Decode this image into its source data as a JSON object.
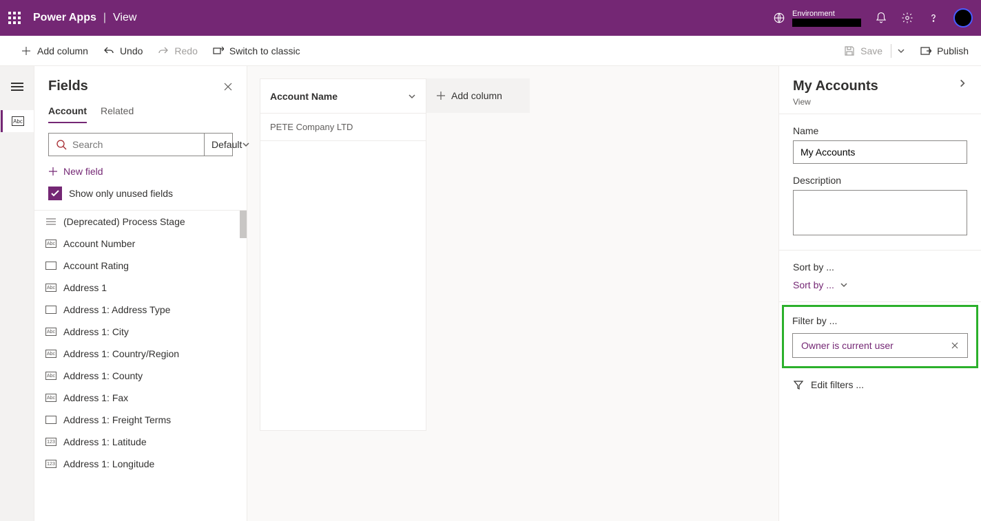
{
  "header": {
    "brand": "Power Apps",
    "page": "View",
    "environment_label": "Environment",
    "environment_value": "████████"
  },
  "cmdbar": {
    "add_column": "Add column",
    "undo": "Undo",
    "redo": "Redo",
    "switch_classic": "Switch to classic",
    "save": "Save",
    "publish": "Publish"
  },
  "fields": {
    "title": "Fields",
    "tab_account": "Account",
    "tab_related": "Related",
    "search_placeholder": "Search",
    "filter_default": "Default",
    "new_field": "New field",
    "show_unused": "Show only unused fields",
    "items": [
      {
        "icon": "list",
        "label": "(Deprecated) Process Stage"
      },
      {
        "icon": "abc",
        "label": "Account Number"
      },
      {
        "icon": "box",
        "label": "Account Rating"
      },
      {
        "icon": "abcdef",
        "label": "Address 1"
      },
      {
        "icon": "box",
        "label": "Address 1: Address Type"
      },
      {
        "icon": "abc",
        "label": "Address 1: City"
      },
      {
        "icon": "abc",
        "label": "Address 1: Country/Region"
      },
      {
        "icon": "abc",
        "label": "Address 1: County"
      },
      {
        "icon": "abc",
        "label": "Address 1: Fax"
      },
      {
        "icon": "box",
        "label": "Address 1: Freight Terms"
      },
      {
        "icon": "123",
        "label": "Address 1: Latitude"
      },
      {
        "icon": "123",
        "label": "Address 1: Longitude"
      }
    ]
  },
  "canvas": {
    "column_header": "Account Name",
    "row1": "PETE Company LTD",
    "add_column": "Add column"
  },
  "props": {
    "title": "My Accounts",
    "subtitle": "View",
    "name_label": "Name",
    "name_value": "My Accounts",
    "desc_label": "Description",
    "desc_value": "",
    "sort_label": "Sort by ...",
    "sort_value": "Sort by ...",
    "filter_label": "Filter by ...",
    "filter_chip": "Owner is current user",
    "edit_filters": "Edit filters ..."
  }
}
